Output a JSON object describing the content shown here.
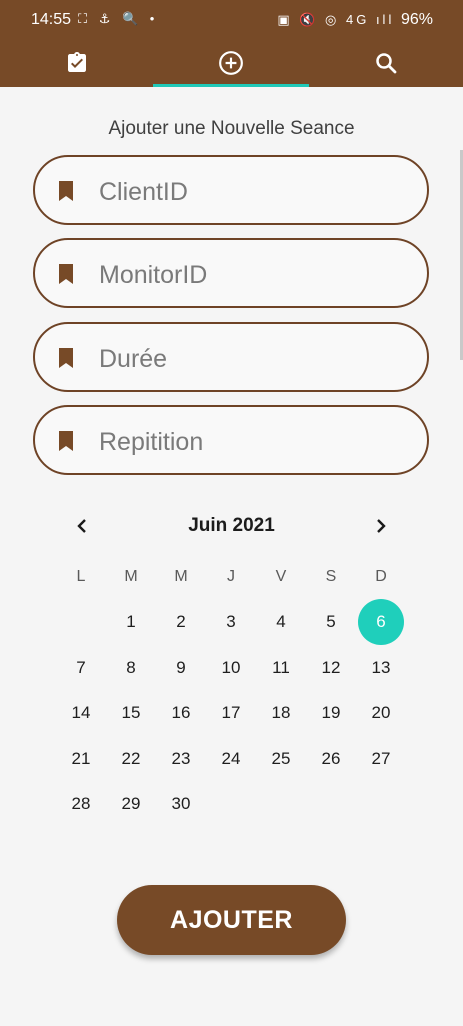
{
  "status_bar": {
    "time": "14:55",
    "left_icons": "⛶ ⚓ 🔍 •",
    "right_icons": "▣ 🔇 ◎ 4G ıll",
    "battery": "96%"
  },
  "tabs": [
    {
      "name": "clipboard-check-icon"
    },
    {
      "name": "add-circle-icon",
      "active": true
    },
    {
      "name": "search-icon"
    }
  ],
  "form": {
    "title": "Ajouter une Nouvelle Seance",
    "fields": [
      {
        "placeholder": "ClientID",
        "value": ""
      },
      {
        "placeholder": "MonitorID",
        "value": ""
      },
      {
        "placeholder": "Durée",
        "value": ""
      },
      {
        "placeholder": "Repitition",
        "value": ""
      }
    ]
  },
  "calendar": {
    "month_label": "Juin 2021",
    "weekdays": [
      "L",
      "M",
      "M",
      "J",
      "V",
      "S",
      "D"
    ],
    "first_weekday_index": 1,
    "days_in_month": 30,
    "selected_day": 6
  },
  "submit_label": "AJOUTER",
  "colors": {
    "primary": "#774a27",
    "accent": "#1fcfbb"
  }
}
